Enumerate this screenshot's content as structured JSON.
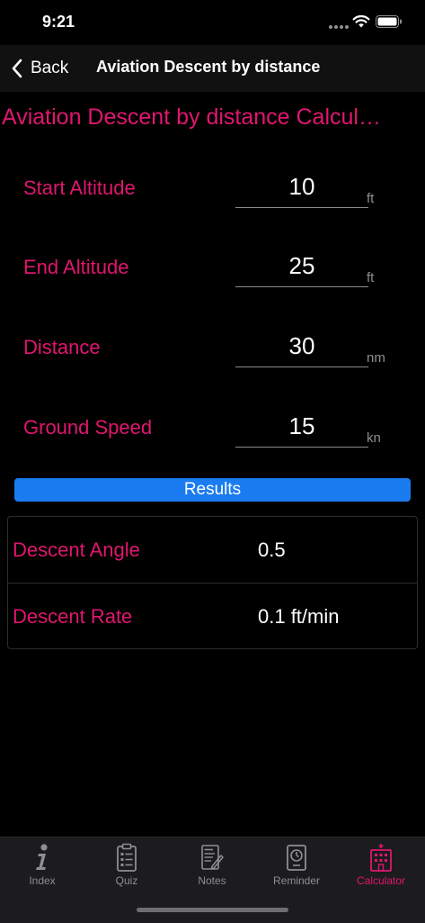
{
  "status_bar": {
    "time": "9:21"
  },
  "nav": {
    "back_label": "Back",
    "title": "Aviation Descent by distance"
  },
  "calculator": {
    "heading": "Aviation Descent by distance Calcul…",
    "inputs": [
      {
        "label": "Start Altitude",
        "value": "10",
        "unit": "ft"
      },
      {
        "label": "End Altitude",
        "value": "25",
        "unit": "ft"
      },
      {
        "label": "Distance",
        "value": "30",
        "unit": "nm"
      },
      {
        "label": "Ground Speed",
        "value": "15",
        "unit": "kn"
      }
    ]
  },
  "results": {
    "header": "Results",
    "rows": [
      {
        "label": "Descent Angle",
        "value": "0.5"
      },
      {
        "label": "Descent Rate",
        "value": "0.1 ft/min"
      }
    ]
  },
  "tabs": [
    {
      "label": "Index",
      "icon": "info-icon",
      "active": false
    },
    {
      "label": "Quiz",
      "icon": "clipboard-icon",
      "active": false
    },
    {
      "label": "Notes",
      "icon": "notes-icon",
      "active": false
    },
    {
      "label": "Reminder",
      "icon": "clock-icon",
      "active": false
    },
    {
      "label": "Calculator",
      "icon": "calculator-icon",
      "active": true
    }
  ],
  "colors": {
    "accent": "#e0166f",
    "results_bar": "#1a7cf0",
    "background": "#000000",
    "tab_bar": "#1c1c1e"
  }
}
